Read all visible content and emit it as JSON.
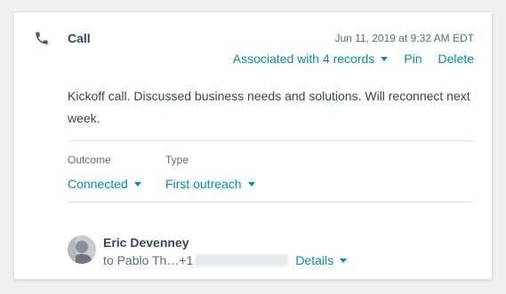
{
  "activity": {
    "type_icon": "phone-icon",
    "title": "Call",
    "timestamp": "Jun 11, 2019 at 9:32 AM EDT",
    "associated_label": "Associated with 4 records",
    "pin_label": "Pin",
    "delete_label": "Delete",
    "body": "Kickoff call. Discussed business needs and solutions. Will reconnect next week."
  },
  "fields": {
    "outcome_label": "Outcome",
    "outcome_value": "Connected",
    "type_label": "Type",
    "type_value": "First outreach"
  },
  "contact": {
    "name": "Eric Devenney",
    "to_text": "to Pablo Th…+1",
    "details_label": "Details"
  },
  "colors": {
    "accent": "#0091ae",
    "text": "#33475b",
    "muted": "#516f90",
    "border": "#dfe3eb"
  }
}
